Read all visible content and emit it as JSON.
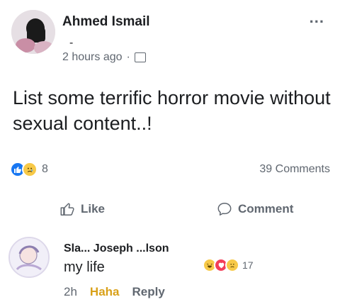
{
  "post": {
    "author": "Ahmed Ismail",
    "author_sub": "-",
    "time": "2 hours ago",
    "separator": "·",
    "more_label": "...",
    "text": "List some terrific horror movie without sexual content..!",
    "reaction_count": "8",
    "comments_count": "39 Comments",
    "icons": [
      "like-icon",
      "sad-icon",
      "globe-icon",
      "more-icon"
    ]
  },
  "actions": {
    "like_label": "Like",
    "comment_label": "Comment"
  },
  "comment": {
    "author": "Sla... Joseph ...lson",
    "text": "my life",
    "time": "2h",
    "reaction_label": "Haha",
    "reply_label": "Reply",
    "reaction_count": "17"
  },
  "colors": {
    "accent": "#1877f2",
    "haha": "#d9a11a",
    "love": "#f33e58",
    "muted_text": "#606770"
  }
}
